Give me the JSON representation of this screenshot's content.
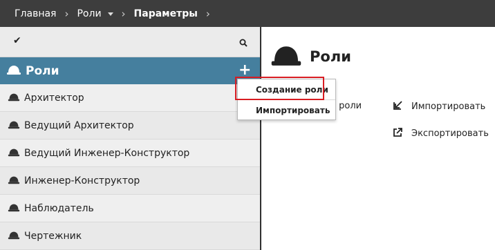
{
  "breadcrumb": {
    "home": "Главная",
    "roles": "Роли",
    "current": "Параметры"
  },
  "sidebar": {
    "header_title": "Роли",
    "items": [
      {
        "label": "Архитектор"
      },
      {
        "label": "Ведущий Архитектор"
      },
      {
        "label": "Ведущий Инженер-Конструктор"
      },
      {
        "label": "Инженер-Конструктор"
      },
      {
        "label": "Наблюдатель"
      },
      {
        "label": "Чертежник"
      }
    ]
  },
  "main": {
    "title": "Роли",
    "create_partial": "е роли",
    "import_label": "Импортировать",
    "export_label": "Экспортировать"
  },
  "dropdown": {
    "create_role": "Создание роли",
    "import": "Импортировать"
  },
  "colors": {
    "topbar": "#3d3d3d",
    "header_accent": "#457f9e",
    "highlight": "#d81c22"
  }
}
